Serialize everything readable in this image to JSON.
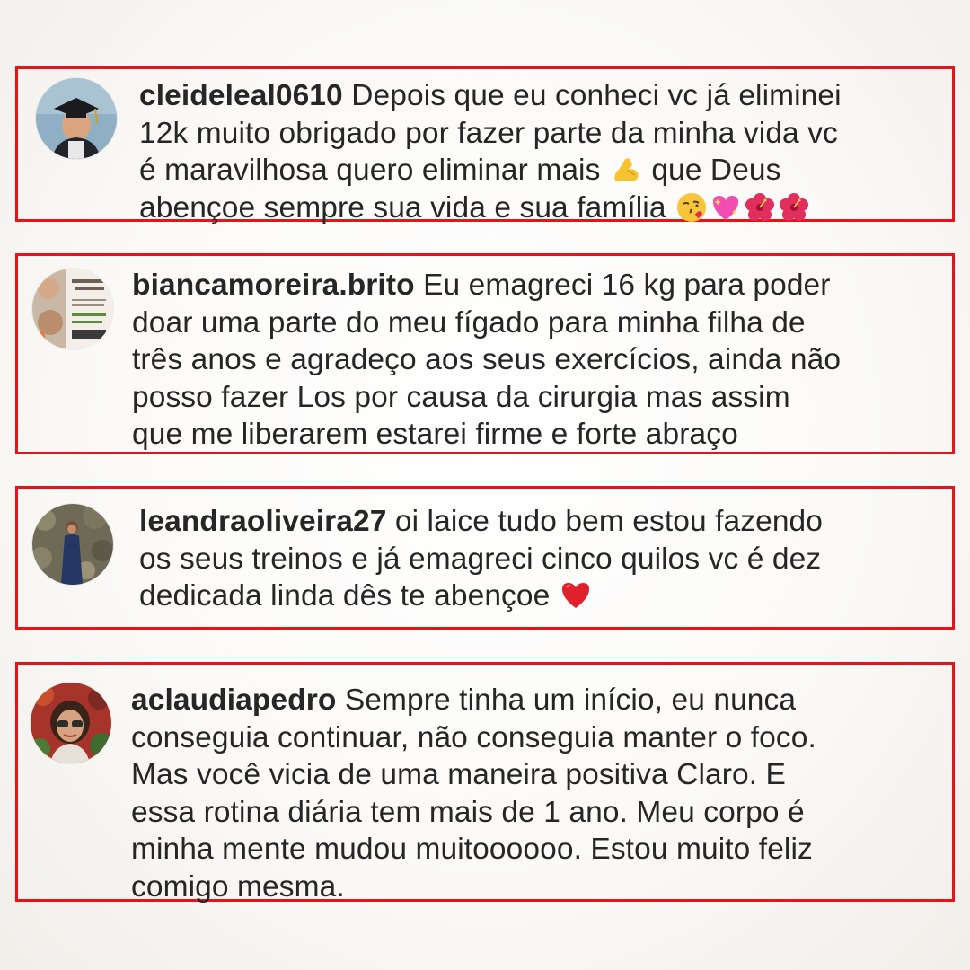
{
  "accent_color": "#e3151a",
  "comments": [
    {
      "username": "cleideleal0610",
      "lines": [
        "Depois que eu conheci vc já eliminei",
        "12k muito obrigado por fazer parte da minha vida vc",
        "é maravilhosa quero eliminar mais",
        "que Deus",
        "abençoe sempre sua vida e sua família"
      ],
      "emojis": [
        "flexed-biceps",
        "face-blowing-kiss",
        "sparkling-heart",
        "hibiscus",
        "hibiscus"
      ]
    },
    {
      "username": "biancamoreira.brito",
      "lines": [
        "Eu emagreci 16 kg para poder",
        "doar uma parte do meu fígado para minha filha de",
        "três anos e agradeço aos seus exercícios, ainda não",
        "posso fazer Los por causa da cirurgia mas assim",
        "que me liberarem estarei firme e forte abraço"
      ],
      "emojis": []
    },
    {
      "username": "leandraoliveira27",
      "lines": [
        "oi laice tudo bem estou fazendo",
        "os seus treinos e já emagreci cinco quilos vc é dez",
        "dedicada linda dês te abençoe"
      ],
      "emojis": [
        "red-heart"
      ]
    },
    {
      "username": "aclaudiapedro",
      "lines": [
        "Sempre tinha um início, eu nunca",
        "conseguia continuar,  não conseguia  manter o foco.",
        "Mas você  vicia de uma maneira positiva  Claro. E",
        "essa rotina diária tem mais de 1 ano. Meu corpo é",
        "minha mente mudou muitoooooo. Estou muito feliz",
        "comigo mesma."
      ],
      "emojis": []
    }
  ]
}
